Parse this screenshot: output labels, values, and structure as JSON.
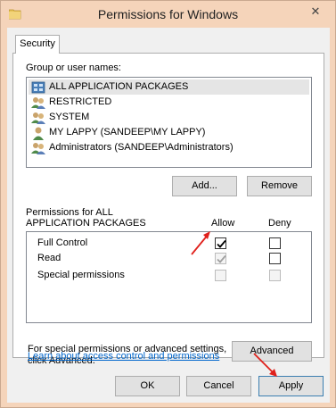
{
  "window": {
    "title": "Permissions for Windows",
    "close_glyph": "✕"
  },
  "tabs": [
    {
      "label": "Security"
    }
  ],
  "group_section": {
    "label": "Group or user names:",
    "users": [
      {
        "name": "ALL APPLICATION PACKAGES",
        "icon": "application-packages-icon",
        "selected": true
      },
      {
        "name": "RESTRICTED",
        "icon": "group-icon",
        "selected": false
      },
      {
        "name": "SYSTEM",
        "icon": "group-icon",
        "selected": false
      },
      {
        "name": "MY LAPPY (SANDEEP\\MY LAPPY)",
        "icon": "user-icon",
        "selected": false
      },
      {
        "name": "Administrators (SANDEEP\\Administrators)",
        "icon": "group-icon",
        "selected": false
      }
    ],
    "add_label": "Add...",
    "remove_label": "Remove"
  },
  "permissions_section": {
    "label_line1": "Permissions for ALL",
    "label_line2": "APPLICATION PACKAGES",
    "allow_header": "Allow",
    "deny_header": "Deny",
    "rows": [
      {
        "name": "Full Control",
        "allow": true,
        "allow_disabled": false,
        "deny": false,
        "deny_disabled": false
      },
      {
        "name": "Read",
        "allow": true,
        "allow_disabled": true,
        "deny": false,
        "deny_disabled": false
      },
      {
        "name": "Special permissions",
        "allow": false,
        "allow_disabled": true,
        "deny": false,
        "deny_disabled": true
      }
    ]
  },
  "advanced_section": {
    "line1": "For special permissions or advanced settings,",
    "line2": "click Advanced.",
    "advanced_label": "Advanced"
  },
  "help_link": "Learn about access control and permissions",
  "footer": {
    "ok_label": "OK",
    "cancel_label": "Cancel",
    "apply_label": "Apply"
  },
  "colors": {
    "frame": "#f5d4ba",
    "annotation_arrow": "#e0201b",
    "link": "#0066cc"
  }
}
